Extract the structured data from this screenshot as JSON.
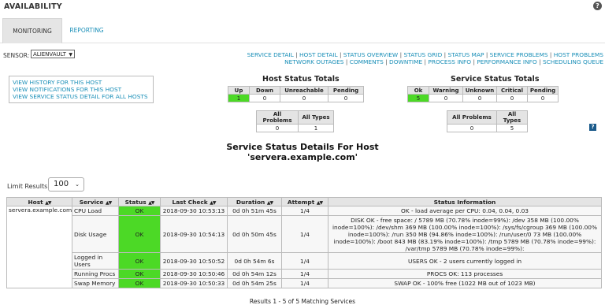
{
  "page": {
    "title": "AVAILABILITY",
    "help": "?"
  },
  "tabs": [
    {
      "label": "MONITORING"
    },
    {
      "label": "REPORTING"
    }
  ],
  "sensor": {
    "label": "SENSOR:",
    "value": "ALIENVAULT"
  },
  "nav": {
    "row1": [
      "SERVICE DETAIL",
      "HOST DETAIL",
      "STATUS OVERVIEW",
      "STATUS GRID",
      "STATUS MAP",
      "SERVICE PROBLEMS",
      "HOST PROBLEMS"
    ],
    "row2": [
      "NETWORK OUTAGES",
      "COMMENTS",
      "DOWNTIME",
      "PROCESS INFO",
      "PERFORMANCE INFO",
      "SCHEDULING QUEUE"
    ],
    "separator": "|"
  },
  "host_links": [
    "VIEW HISTORY FOR THIS HOST",
    "VIEW NOTIFICATIONS FOR THIS HOST",
    "VIEW SERVICE STATUS DETAIL FOR ALL HOSTS"
  ],
  "host_totals": {
    "title": "Host Status Totals",
    "headers": [
      "Up",
      "Down",
      "Unreachable",
      "Pending"
    ],
    "values": [
      "1",
      "0",
      "0",
      "0"
    ],
    "sub_headers": [
      "All Problems",
      "All Types"
    ],
    "sub_values": [
      "0",
      "1"
    ]
  },
  "service_totals": {
    "title": "Service Status Totals",
    "headers": [
      "Ok",
      "Warning",
      "Unknown",
      "Critical",
      "Pending"
    ],
    "values": [
      "5",
      "0",
      "0",
      "0",
      "0"
    ],
    "sub_headers": [
      "All Problems",
      "All Types"
    ],
    "sub_values": [
      "0",
      "5"
    ]
  },
  "details": {
    "title": "Service Status Details For Host",
    "host": "'servera.example.com'",
    "help": "?"
  },
  "limit": {
    "label": "Limit Results:",
    "value": "100"
  },
  "table": {
    "headers": [
      "Host",
      "Service",
      "Status",
      "Last Check",
      "Duration",
      "Attempt",
      "Status Information"
    ],
    "sort_glyph": "▲▼",
    "host": "servera.example.com",
    "rows": [
      {
        "service": "CPU Load",
        "status": "OK",
        "last_check": "2018-09-30 10:53:13",
        "duration": "0d 0h 51m 45s",
        "attempt": "1/4",
        "info": "OK - load average per CPU: 0.04, 0.04, 0.03"
      },
      {
        "service": "Disk Usage",
        "status": "OK",
        "last_check": "2018-09-30 10:54:13",
        "duration": "0d 0h 50m 45s",
        "attempt": "1/4",
        "info": "DISK OK - free space: / 5789 MB (70.78% inode=99%): /dev 358 MB (100.00% inode=100%): /dev/shm 369 MB (100.00% inode=100%): /sys/fs/cgroup 369 MB (100.00% inode=100%): /run 350 MB (94.86% inode=100%): /run/user/0 73 MB (100.00% inode=100%): /boot 843 MB (83.19% inode=100%): /tmp 5789 MB (70.78% inode=99%): /var/tmp 5789 MB (70.78% inode=99%):"
      },
      {
        "service": "Logged in Users",
        "status": "OK",
        "last_check": "2018-09-30 10:50:52",
        "duration": "0d 0h 54m 6s",
        "attempt": "1/4",
        "info": "USERS OK - 2 users currently logged in"
      },
      {
        "service": "Running Procs",
        "status": "OK",
        "last_check": "2018-09-30 10:50:46",
        "duration": "0d 0h 54m 12s",
        "attempt": "1/4",
        "info": "PROCS OK: 113 processes"
      },
      {
        "service": "Swap Memory",
        "status": "OK",
        "last_check": "2018-09-30 10:50:33",
        "duration": "0d 0h 54m 25s",
        "attempt": "1/4",
        "info": "SWAP OK - 100% free (1022 MB out of 1023 MB)"
      }
    ]
  },
  "results": "Results 1 - 5 of 5 Matching Services",
  "colors": {
    "ok": "#4cd926",
    "link": "#1a8fb8"
  }
}
